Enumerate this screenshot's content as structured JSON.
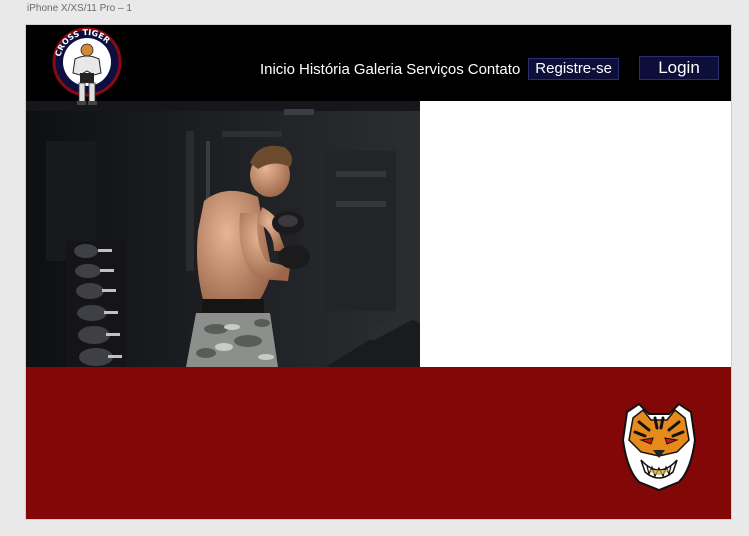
{
  "artboard": {
    "label": "iPhone X/XS/11 Pro – 1"
  },
  "header": {
    "logo_text_top": "CROSS",
    "logo_text_top2": "TIGER",
    "nav": [
      {
        "label": "Inicio"
      },
      {
        "label": "História"
      },
      {
        "label": "Galeria"
      },
      {
        "label": "Serviços"
      },
      {
        "label": "Contato"
      }
    ],
    "register_label": "Registre-se",
    "login_label": "Login"
  },
  "colors": {
    "header_bg": "#000000",
    "footer_bg": "#820808",
    "button_bg": "#0d0f3a"
  }
}
